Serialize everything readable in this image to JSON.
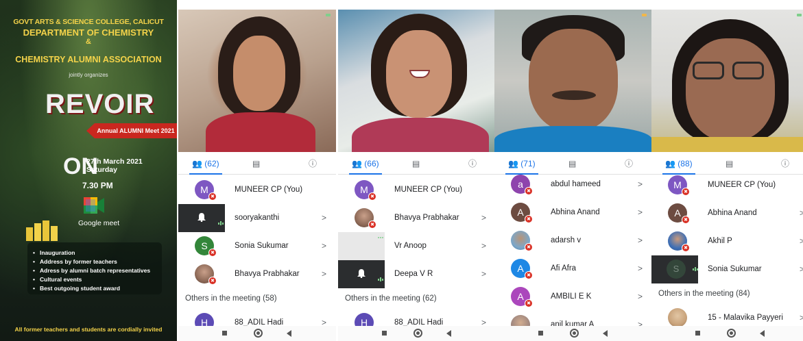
{
  "poster": {
    "college": "GOVT ARTS & SCIENCE COLLEGE, CALICUT",
    "department": "DEPARTMENT OF CHEMISTRY",
    "ampersand": "&",
    "association": "CHEMISTRY ALUMNI ASSOCIATION",
    "jointly": "jointly organizes",
    "title": "REVOIR",
    "ribbon": "Annual ALUMNI Meet 2021",
    "on": "ON",
    "date": "27th March 2021",
    "day": "Saturday",
    "time": "7.30 PM",
    "meet_label": "Google meet",
    "events": [
      "Inauguration",
      "Address by former teachers",
      "Adress by alumni batch representatives",
      "Cultural events",
      "Best outgoing student award"
    ],
    "invite": "All former teachers and students are cordially invited"
  },
  "panels": [
    {
      "participants_count": "(62)",
      "rows": [
        {
          "kind": "avatar",
          "letter": "M",
          "color": "#7e57c2",
          "name": "MUNEER CP (You)",
          "muted": true,
          "chevron": ""
        },
        {
          "kind": "tile",
          "name": "sooryakanthi",
          "chevron": ">"
        },
        {
          "kind": "avatar",
          "letter": "S",
          "color": "#33863a",
          "name": "Sonia Sukumar",
          "muted": true,
          "chevron": ">"
        },
        {
          "kind": "photo",
          "color": "#b89a86",
          "name": "Bhavya Prabhakar",
          "muted": true,
          "chevron": ">"
        }
      ],
      "others": "Others in the meeting (58)",
      "tail": {
        "letter": "H",
        "color": "#5c4bb5",
        "name": "88_ADIL Hadi",
        "chevron": ">"
      }
    },
    {
      "participants_count": "(66)",
      "rows": [
        {
          "kind": "avatar",
          "letter": "M",
          "color": "#7e57c2",
          "name": "MUNEER CP (You)",
          "muted": true,
          "chevron": ""
        },
        {
          "kind": "photo",
          "color": "#b89a86",
          "name": "Bhavya Prabhakar",
          "muted": true,
          "chevron": ">"
        },
        {
          "kind": "tile",
          "name": "Vr Anoop",
          "chevron": ">"
        },
        {
          "kind": "tile",
          "name": "Deepa V R",
          "chevron": ">"
        }
      ],
      "others": "Others in the meeting (62)",
      "tail": {
        "letter": "H",
        "color": "#5c4bb5",
        "name": "88_ADIL Hadi",
        "chevron": ">"
      }
    },
    {
      "participants_count": "(71)",
      "rows": [
        {
          "kind": "avatar",
          "letter": "a",
          "color": "#8e44ad",
          "name": "abdul hameed",
          "muted": true,
          "chevron": ">"
        },
        {
          "kind": "avatar",
          "letter": "A",
          "color": "#6d4c41",
          "name": "Abhina Anand",
          "muted": true,
          "chevron": ">"
        },
        {
          "kind": "photo",
          "color": "#7da7c8",
          "name": "adarsh v",
          "muted": true,
          "chevron": ">"
        },
        {
          "kind": "avatar",
          "letter": "A",
          "color": "#1e88e5",
          "name": "Afi Afra",
          "muted": true,
          "chevron": ">"
        },
        {
          "kind": "avatar",
          "letter": "A",
          "color": "#ab47bc",
          "name": "AMBILI E K",
          "muted": true,
          "chevron": ">"
        }
      ],
      "others": "",
      "tail": {
        "letter": "",
        "color": "#a1887f",
        "name": "anil kumar A",
        "chevron": ">"
      }
    },
    {
      "participants_count": "(88)",
      "rows": [
        {
          "kind": "avatar",
          "letter": "M",
          "color": "#7e57c2",
          "name": "MUNEER CP (You)",
          "muted": true,
          "chevron": ""
        },
        {
          "kind": "avatar",
          "letter": "A",
          "color": "#6d4c41",
          "name": "Abhina Anand",
          "muted": true,
          "chevron": ">"
        },
        {
          "kind": "photo",
          "color": "#3f6fb5",
          "name": "Akhil P",
          "muted": true,
          "chevron": ">"
        },
        {
          "kind": "tile",
          "name": "Sonia Sukumar",
          "chevron": ">"
        }
      ],
      "others": "Others in the meeting (84)",
      "tail": {
        "letter": "",
        "color": "#c8a27a",
        "name": "15 - Malavika Payyeri",
        "chevron": ">"
      }
    }
  ],
  "colors": {
    "accent_blue": "#1a73e8",
    "muted_red": "#d93025",
    "poster_yellow": "#f4d34a"
  }
}
